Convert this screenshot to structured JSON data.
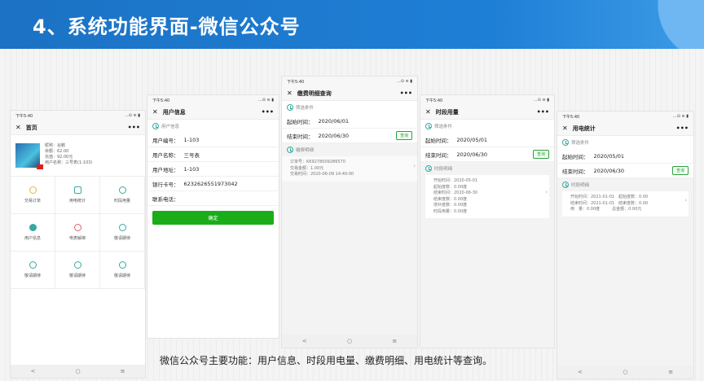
{
  "header": {
    "title": "4、系统功能界面-微信公众号"
  },
  "caption": "微信公众号主要功能：用户信息、时段用电量、缴费明细、用电统计等查询。",
  "status": {
    "time": "下午5:40",
    "icons": "...⊙ ≋ ▮"
  },
  "nav": {
    "back": "<",
    "home": "○",
    "menu": "≡"
  },
  "home": {
    "title": "首页",
    "profile": {
      "nickname": "昵称：",
      "nickname_val": "谷鹏",
      "balance": "余额：62.00",
      "deposit": "充值：92.00元",
      "user": "用户名称：三号表(1-103)"
    },
    "grid": [
      "交易订单",
      "用电统计",
      "时段用量",
      "用户信息",
      "电表解绑",
      "敬请期待",
      "敬请期待",
      "敬请期待",
      "敬请期待"
    ]
  },
  "userinfo": {
    "title": "用户信息",
    "section": "用户信息",
    "fields": [
      {
        "label": "用户编号：",
        "value": "1-103"
      },
      {
        "label": "用户名称：",
        "value": "三号表"
      },
      {
        "label": "用户地址：",
        "value": "1-103"
      },
      {
        "label": "银行卡号：",
        "value": "6232626551973042"
      },
      {
        "label": "联系电话：",
        "value": ""
      }
    ],
    "confirm": "确定"
  },
  "payment": {
    "title": "缴费明细查询",
    "filter": "筛选条件",
    "start_label": "起始时间：",
    "start": "2020/06/01",
    "end_label": "结束时间：",
    "end": "2020/06/30",
    "query": "查询",
    "detail": "缴费明细",
    "lines": [
      "订单号：KK9278009286570",
      "交易金额：1.00元",
      "交易时间：2020-06-09 14:40:00"
    ]
  },
  "period": {
    "title": "时段用量",
    "filter": "筛选条件",
    "start_label": "起始时间：",
    "start": "2020/05/01",
    "end_label": "结束时间：",
    "end": "2020/06/30",
    "query": "查询",
    "detail": "时段明细",
    "lines": [
      "开始时间：2020-05-01",
      "起始度数：0.00度",
      "结束时间：2020-06-30",
      "结束度数：0.00度",
      "增补度数：0.00度",
      "时段用量：0.00度"
    ]
  },
  "stats": {
    "title": "用电统计",
    "filter": "筛选条件",
    "start_label": "起始时间：",
    "start": "2020/05/01",
    "end_label": "结束时间：",
    "end": "2020/06/30",
    "query": "查询",
    "detail": "时段明细",
    "lines": [
      "开始时间：2021-01-01　起始度数：0.00",
      "结束时间：2021-01-01　结束度数：0.00",
      "用　量：0.00度　　　总金额：0.00元"
    ]
  }
}
